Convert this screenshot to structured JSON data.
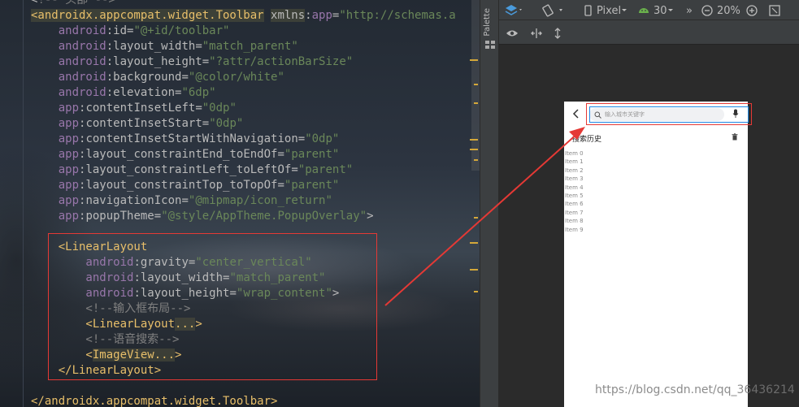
{
  "editor": {
    "lines": [
      {
        "segs": [
          [
            "punct",
            "<"
          ],
          [
            "comment",
            "!-- 头部 -->"
          ]
        ]
      },
      {
        "segs": [
          [
            "kw-tag hl-tag",
            "<androidx.appcompat.widget.Toolbar"
          ],
          [
            "punct",
            " "
          ],
          [
            "attr hl-tag",
            "xmlns"
          ],
          [
            "punct",
            ":"
          ],
          [
            "ns",
            "app"
          ],
          [
            "punct",
            "="
          ],
          [
            "val",
            "\"http://schemas.a"
          ]
        ]
      },
      {
        "segs": [
          [
            "ns",
            "    android"
          ],
          [
            "punct",
            ":"
          ],
          [
            "attr",
            "id"
          ],
          [
            "punct",
            "="
          ],
          [
            "val",
            "\"@+id/toolbar\""
          ]
        ]
      },
      {
        "segs": [
          [
            "ns",
            "    android"
          ],
          [
            "punct",
            ":"
          ],
          [
            "attr",
            "layout_width"
          ],
          [
            "punct",
            "="
          ],
          [
            "val",
            "\"match_parent\""
          ]
        ]
      },
      {
        "segs": [
          [
            "ns",
            "    android"
          ],
          [
            "punct",
            ":"
          ],
          [
            "attr",
            "layout_height"
          ],
          [
            "punct",
            "="
          ],
          [
            "val",
            "\"?attr/actionBarSize\""
          ]
        ]
      },
      {
        "segs": [
          [
            "ns",
            "    android"
          ],
          [
            "punct",
            ":"
          ],
          [
            "attr",
            "background"
          ],
          [
            "punct",
            "="
          ],
          [
            "val",
            "\"@color/white\""
          ]
        ]
      },
      {
        "segs": [
          [
            "ns",
            "    android"
          ],
          [
            "punct",
            ":"
          ],
          [
            "attr",
            "elevation"
          ],
          [
            "punct",
            "="
          ],
          [
            "val",
            "\"6dp\""
          ]
        ]
      },
      {
        "segs": [
          [
            "ns",
            "    app"
          ],
          [
            "punct",
            ":"
          ],
          [
            "attr",
            "contentInsetLeft"
          ],
          [
            "punct",
            "="
          ],
          [
            "val",
            "\"0dp\""
          ]
        ]
      },
      {
        "segs": [
          [
            "ns",
            "    app"
          ],
          [
            "punct",
            ":"
          ],
          [
            "attr",
            "contentInsetStart"
          ],
          [
            "punct",
            "="
          ],
          [
            "val",
            "\"0dp\""
          ]
        ]
      },
      {
        "segs": [
          [
            "ns",
            "    app"
          ],
          [
            "punct",
            ":"
          ],
          [
            "attr",
            "contentInsetStartWithNavigation"
          ],
          [
            "punct",
            "="
          ],
          [
            "val",
            "\"0dp\""
          ]
        ]
      },
      {
        "segs": [
          [
            "ns",
            "    app"
          ],
          [
            "punct",
            ":"
          ],
          [
            "attr",
            "layout_constraintEnd_toEndOf"
          ],
          [
            "punct",
            "="
          ],
          [
            "val",
            "\"parent\""
          ]
        ]
      },
      {
        "segs": [
          [
            "ns",
            "    app"
          ],
          [
            "punct",
            ":"
          ],
          [
            "attr",
            "layout_constraintLeft_toLeftOf"
          ],
          [
            "punct",
            "="
          ],
          [
            "val",
            "\"parent\""
          ]
        ]
      },
      {
        "segs": [
          [
            "ns",
            "    app"
          ],
          [
            "punct",
            ":"
          ],
          [
            "attr",
            "layout_constraintTop_toTopOf"
          ],
          [
            "punct",
            "="
          ],
          [
            "val",
            "\"parent\""
          ]
        ]
      },
      {
        "segs": [
          [
            "ns",
            "    app"
          ],
          [
            "punct",
            ":"
          ],
          [
            "attr",
            "navigationIcon"
          ],
          [
            "punct",
            "="
          ],
          [
            "val",
            "\"@mipmap/icon_return\""
          ]
        ]
      },
      {
        "segs": [
          [
            "ns",
            "    app"
          ],
          [
            "punct",
            ":"
          ],
          [
            "attr",
            "popupTheme"
          ],
          [
            "punct",
            "="
          ],
          [
            "val",
            "\"@style/AppTheme.PopupOverlay\""
          ],
          [
            "punct",
            ">"
          ]
        ]
      },
      {
        "segs": []
      },
      {
        "segs": [
          [
            "kw-tag",
            "    <LinearLayout"
          ]
        ]
      },
      {
        "segs": [
          [
            "ns",
            "        android"
          ],
          [
            "punct",
            ":"
          ],
          [
            "attr",
            "gravity"
          ],
          [
            "punct",
            "="
          ],
          [
            "val",
            "\"center_vertical\""
          ]
        ]
      },
      {
        "segs": [
          [
            "ns",
            "        android"
          ],
          [
            "punct",
            ":"
          ],
          [
            "attr",
            "layout_width"
          ],
          [
            "punct",
            "="
          ],
          [
            "val",
            "\"match_parent\""
          ]
        ]
      },
      {
        "segs": [
          [
            "ns",
            "        android"
          ],
          [
            "punct",
            ":"
          ],
          [
            "attr",
            "layout_height"
          ],
          [
            "punct",
            "="
          ],
          [
            "val",
            "\"wrap_content\""
          ],
          [
            "punct",
            ">"
          ]
        ]
      },
      {
        "segs": [
          [
            "comment",
            "        <!--输入框布局-->"
          ]
        ]
      },
      {
        "segs": [
          [
            "kw-tag",
            "        <LinearLayout"
          ],
          [
            "fold",
            "..."
          ],
          [
            "kw-tag",
            ">"
          ]
        ]
      },
      {
        "segs": [
          [
            "comment",
            "        <!--语音搜索-->"
          ]
        ]
      },
      {
        "segs": [
          [
            "kw-tag",
            "        <"
          ],
          [
            "fold",
            "ImageView..."
          ],
          [
            "kw-tag",
            ">"
          ]
        ]
      },
      {
        "segs": [
          [
            "kw-tag",
            "    </LinearLayout>"
          ]
        ]
      },
      {
        "segs": []
      },
      {
        "segs": [
          [
            "kw-tag",
            "</androidx.appcompat.widget.Toolbar>"
          ]
        ]
      }
    ]
  },
  "palette": {
    "label": "Palette"
  },
  "design_toolbar": {
    "device": "Pixel",
    "api_level": "30",
    "zoom": "20%"
  },
  "preview": {
    "search_placeholder": "输入城市关键字",
    "history_title": "搜索历史",
    "items": [
      "Item 0",
      "Item 1",
      "Item 2",
      "Item 3",
      "Item 4",
      "Item 5",
      "Item 6",
      "Item 7",
      "Item 8",
      "Item 9"
    ]
  },
  "watermark": "https://blog.csdn.net/qq_36436214",
  "colors": {
    "annotation_red": "#e53935",
    "selection_blue": "#1e88e5"
  },
  "icons": [
    "back-arrow-icon",
    "search-icon",
    "mic-icon",
    "trash-icon",
    "layers-icon",
    "orientation-icon",
    "phone-icon",
    "android-icon",
    "zoom-out-icon",
    "zoom-in-icon",
    "zoom-fit-icon",
    "eye-icon",
    "magnet-icon",
    "vertical-arrows-icon"
  ]
}
